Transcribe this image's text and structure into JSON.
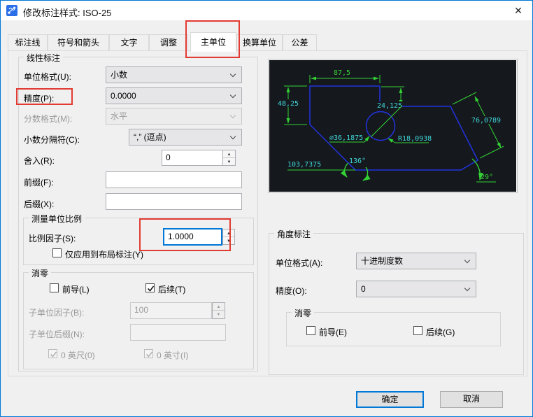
{
  "window": {
    "title": "修改标注样式: ISO-25"
  },
  "icons": {
    "close": "✕",
    "spin_up": "▲",
    "spin_down": "▼"
  },
  "tabs": [
    {
      "label": "标注线",
      "active": false
    },
    {
      "label": "符号和箭头",
      "active": false
    },
    {
      "label": "文字",
      "active": false
    },
    {
      "label": "调整",
      "active": false
    },
    {
      "label": "主单位",
      "active": true
    },
    {
      "label": "换算单位",
      "active": false
    },
    {
      "label": "公差",
      "active": false
    }
  ],
  "linear": {
    "title": "线性标注",
    "unit_format_label": "单位格式(U):",
    "unit_format_value": "小数",
    "precision_label": "精度(P):",
    "precision_value": "0.0000",
    "fraction_label": "分数格式(M):",
    "fraction_value": "水平",
    "fraction_disabled": true,
    "separator_label": "小数分隔符(C):",
    "separator_value": "“,” (逗点)",
    "round_label": "舍入(R):",
    "round_value": "0",
    "prefix_label": "前缀(F):",
    "prefix_value": "",
    "suffix_label": "后缀(X):",
    "suffix_value": ""
  },
  "scale": {
    "title": "测量单位比例",
    "factor_label": "比例因子(S):",
    "factor_value": "1.0000",
    "layout_only_label": "仅应用到布局标注(Y)",
    "layout_only_checked": false
  },
  "zero": {
    "title": "消零",
    "leading_label": "前导(L)",
    "leading_checked": false,
    "trailing_label": "后续(T)",
    "trailing_checked": true,
    "sub_factor_label": "子单位因子(B):",
    "sub_factor_value": "100",
    "sub_factor_disabled": true,
    "sub_suffix_label": "子单位后缀(N):",
    "sub_suffix_value": "",
    "sub_suffix_disabled": true,
    "feet_label": "0 英尺(0)",
    "feet_checked": true,
    "feet_disabled": true,
    "inch_label": "0 英寸(I)",
    "inch_checked": true,
    "inch_disabled": true
  },
  "angular": {
    "title": "角度标注",
    "unit_format_label": "单位格式(A):",
    "unit_format_value": "十进制度数",
    "precision_label": "精度(O):",
    "precision_value": "0",
    "zero_title": "消零",
    "leading_label": "前导(E)",
    "leading_checked": false,
    "trailing_label": "后续(G)",
    "trailing_checked": false
  },
  "preview": {
    "dims": {
      "top": "87,5",
      "left": "48,25",
      "step": "24,125",
      "right": "76,0789",
      "diameter": "⌀36,1875",
      "radius": "R18,0938",
      "bottom": "103,7375",
      "angle1": "136°",
      "angle2": "29°"
    },
    "colors": {
      "background": "#15191e",
      "shape": "#2233dd",
      "dimension": "#34d134",
      "text": "#40d6d6"
    }
  },
  "buttons": {
    "ok": "确定",
    "cancel": "取消"
  },
  "annotations": {
    "color": "#e23b32",
    "targets": [
      "主单位-tab",
      "精度(P)-label",
      "比例因子-spinner"
    ]
  }
}
